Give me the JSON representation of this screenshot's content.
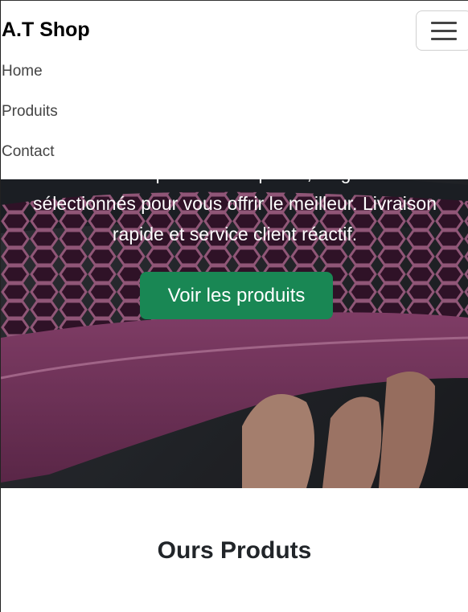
{
  "navbar": {
    "brand": "A.T Shop",
    "links": [
      "Home",
      "Produits",
      "Contact"
    ]
  },
  "hero": {
    "text_line_hidden": "Découvrez nos produits de qualité, soigneusement",
    "text": "sélectionnés pour vous offrir le meilleur. Livraison rapide et service client réactif.",
    "button_label": "Voir les produits"
  },
  "products_section": {
    "title": "Ours Produts"
  },
  "colors": {
    "button": "#198754",
    "shoe": "#8a3f6e"
  }
}
